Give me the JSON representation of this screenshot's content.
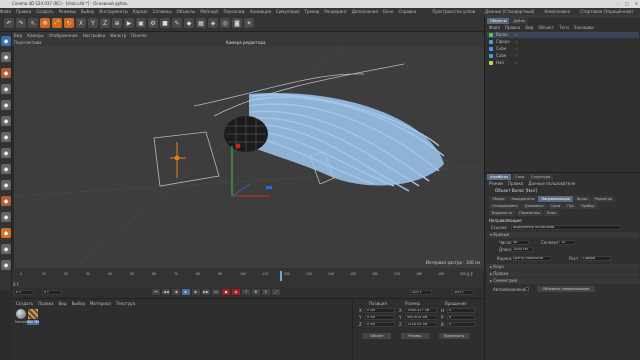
{
  "window": {
    "title": "Cinema 4D S24.037 (RC) - [shot.c4d *] - Основной дубль"
  },
  "menubar": {
    "items": [
      "Файл",
      "Правка",
      "Создать",
      "Режимы",
      "Выбор",
      "Инструменты",
      "Каркас",
      "Сплайны",
      "Объекты",
      "MoGraph",
      "Персонаж",
      "Анимация",
      "Симуляция",
      "Трекер",
      "Рендеринг",
      "Дополнения",
      "Окно",
      "Справка"
    ],
    "right": [
      "Пространство узлов",
      "Данные (Стандартный)",
      "Компоновка",
      "Стартовая (Упрощённая)"
    ]
  },
  "viewport": {
    "menu": [
      "Вид",
      "Камеры",
      "Отображение",
      "Настройки",
      "Фильтр",
      "Панели"
    ],
    "label": "Перспектива",
    "camera": "Камера редактора",
    "grid_info": "Интервал растра : 100 см"
  },
  "timeline": {
    "ticks": [
      "0",
      "10",
      "20",
      "30",
      "40",
      "50",
      "60",
      "70",
      "80",
      "90",
      "100",
      "110",
      "120",
      "130",
      "140",
      "150",
      "160",
      "170",
      "180",
      "190",
      "200"
    ],
    "current": "0 F",
    "start": "0 F",
    "end": "200 F",
    "end2": "200 F",
    "frame_right": "0 F"
  },
  "materials": {
    "menu": [
      "Создать",
      "Правка",
      "Вид",
      "Выбор",
      "Материал",
      "Текстура"
    ],
    "items": [
      "Матери",
      "Hair Ma"
    ]
  },
  "coords": {
    "headers": [
      "Позиция",
      "Размер",
      "Вращение"
    ],
    "rows": [
      {
        "axis": "X",
        "pos": "0 см",
        "size": "1384.527 см",
        "rot_axis": "H",
        "rot": "0 °"
      },
      {
        "axis": "Y",
        "pos": "0 см",
        "size": "980.615 см",
        "rot_axis": "P",
        "rot": "0 °"
      },
      {
        "axis": "Z",
        "pos": "0 см",
        "size": "1328.55 см",
        "rot_axis": "B",
        "rot": "0 °"
      }
    ],
    "mode": "Объект",
    "size_mode": "Размер",
    "apply": "Применить"
  },
  "objects": {
    "tabs": [
      "Объекты",
      "Дубли"
    ],
    "menu": [
      "Файл",
      "Правка",
      "Вид",
      "Объект",
      "Теги",
      "Закладки"
    ],
    "list": [
      {
        "name": "Волос",
        "color": "#60c060"
      },
      {
        "name": "Сфера",
        "color": "#4a9be0"
      },
      {
        "name": "Cube",
        "color": "#4a9be0"
      },
      {
        "name": "Cube",
        "color": "#4a9be0"
      },
      {
        "name": "Hair",
        "color": "#d0d040"
      }
    ]
  },
  "attributes": {
    "tabs": [
      "Атрибуты",
      "Слои",
      "Структура"
    ],
    "menu": [
      "Режим",
      "Правка",
      "Данные пользователя"
    ],
    "object_title": "Объект Волос [Hair]",
    "subtabs_row1": [
      "Общее",
      "Координаты",
      "Направляющие",
      "Волос",
      "Редактор"
    ],
    "subtabs_row2": [
      "Генерировать",
      "Динамика",
      "Силы",
      "Пух",
      "Пробор"
    ],
    "subtabs_row3": [
      "Видимость",
      "Параметры",
      "Влиз"
    ],
    "section": "Направляющие",
    "link_label": "Ссылка",
    "link_value": "Выделение полигонов",
    "group": "Кривые",
    "count_label": "Число",
    "count_value": "4k",
    "segments_label": "Сегменты",
    "segments_value": "10",
    "length_label": "Длина",
    "length_value": "1000 см",
    "root_label": "Корень",
    "root_value": "Центр полигона",
    "growth_label": "Рост",
    "growth_value": "Сферa",
    "collapsed": [
      "Корн",
      "Правка",
      "Симметрия"
    ],
    "auto_label": "Автообновление",
    "auto_btn": "Обновить направляющие"
  }
}
